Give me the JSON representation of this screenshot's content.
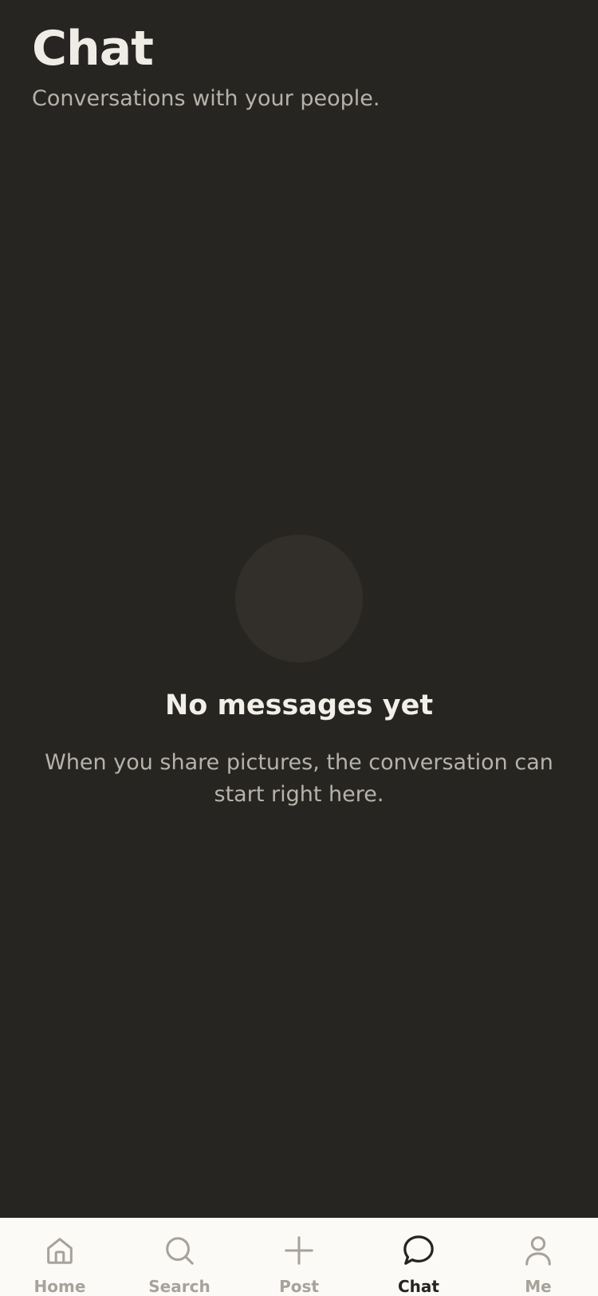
{
  "header": {
    "title": "Chat",
    "subtitle": "Conversations with your people."
  },
  "empty_state": {
    "title": "No messages yet",
    "body": "When you share pictures, the conversation can start right here."
  },
  "tabbar": {
    "active": "chat",
    "tabs": [
      {
        "id": "home",
        "label": "Home",
        "icon": "home-icon"
      },
      {
        "id": "search",
        "label": "Search",
        "icon": "search-icon"
      },
      {
        "id": "post",
        "label": "Post",
        "icon": "plus-icon"
      },
      {
        "id": "chat",
        "label": "Chat",
        "icon": "chat-bubble-icon"
      },
      {
        "id": "me",
        "label": "Me",
        "icon": "person-icon"
      }
    ]
  },
  "colors": {
    "background": "#262522",
    "tabbar_background": "#fbfaf7",
    "active_tab": "#26241f",
    "inactive_tab": "#a7a29a"
  }
}
